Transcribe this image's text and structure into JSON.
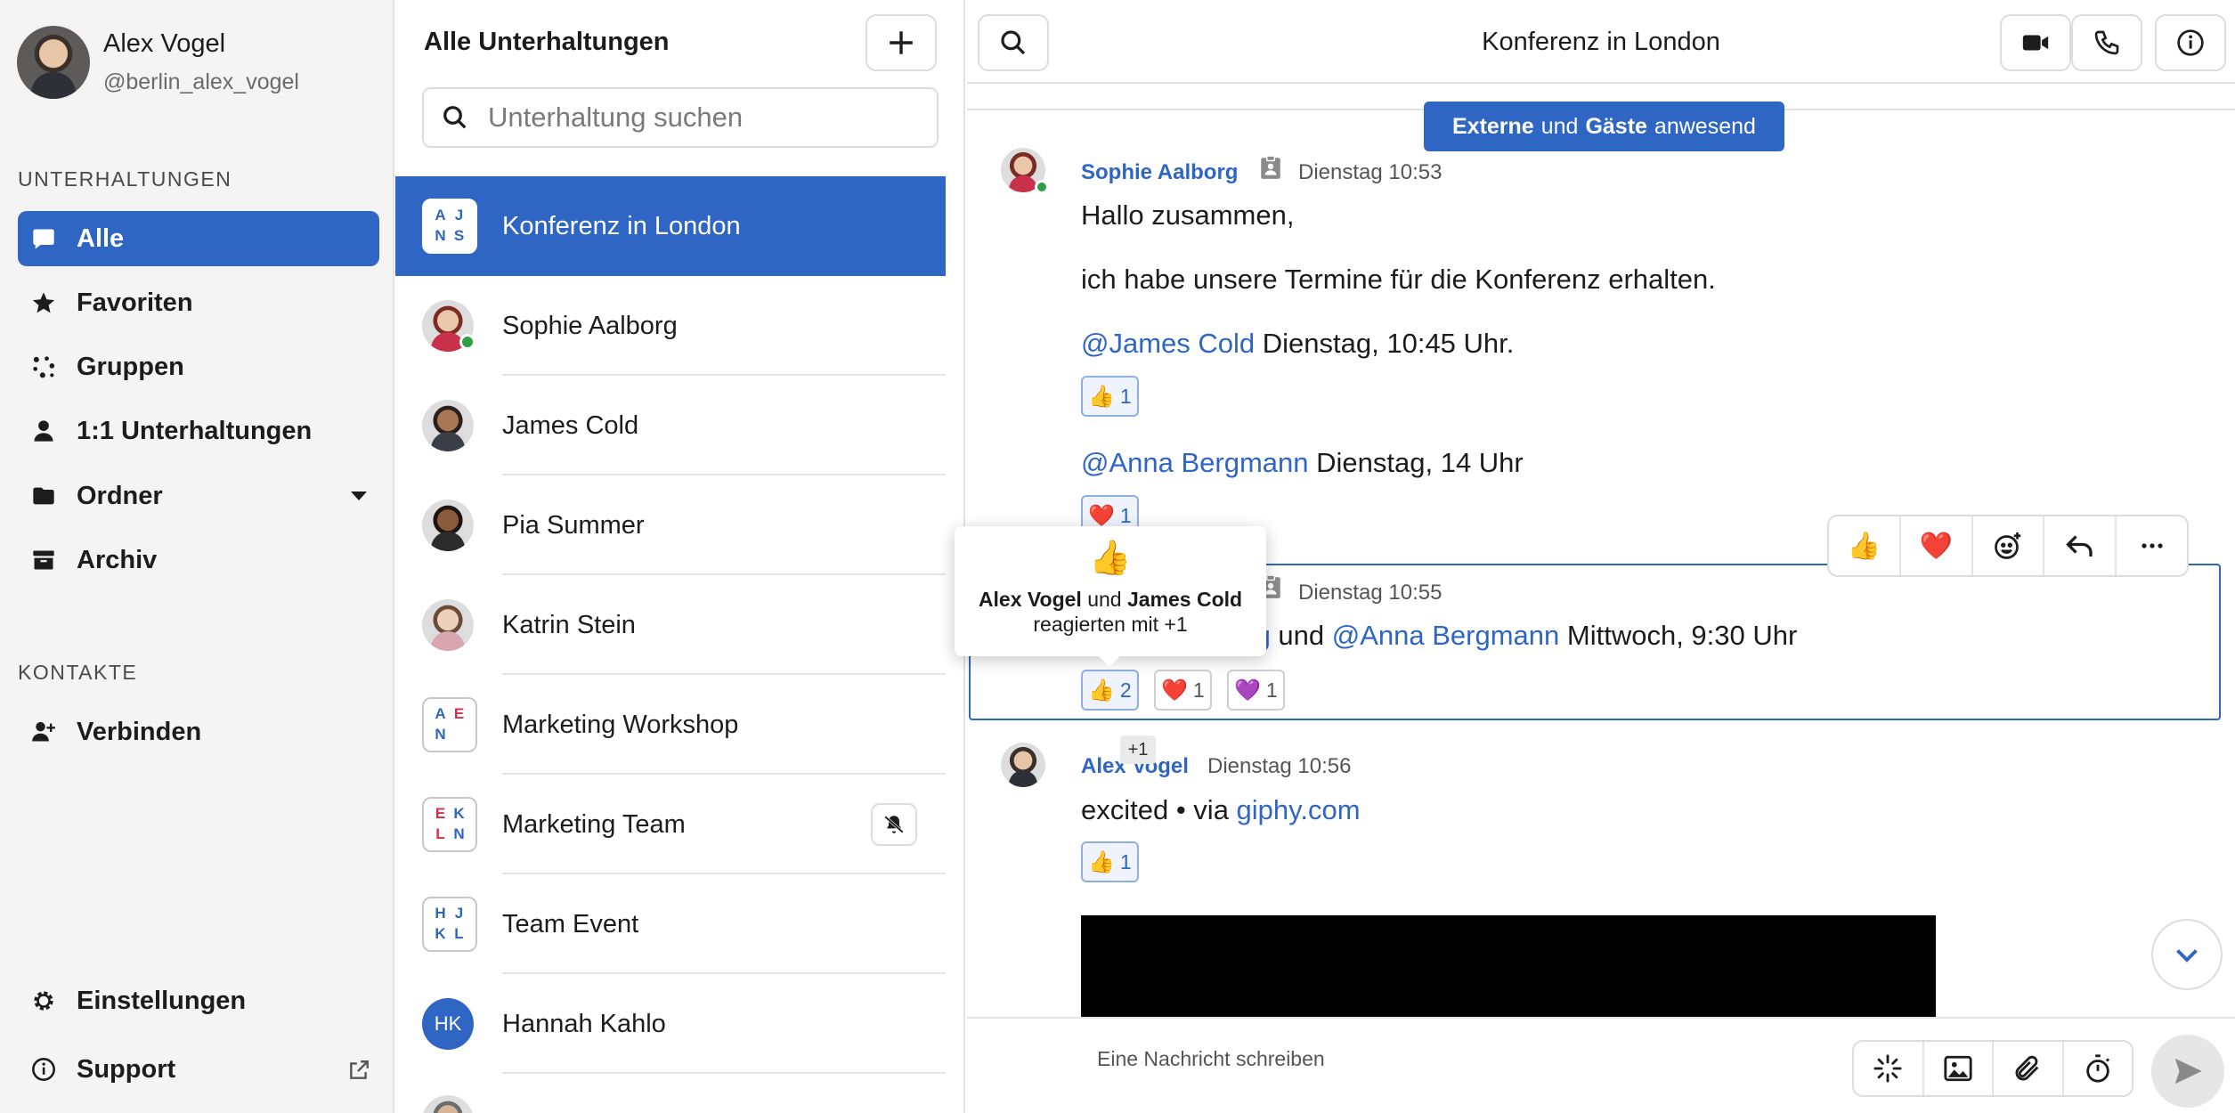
{
  "profile": {
    "name": "Alex Vogel",
    "handle": "@berlin_alex_vogel"
  },
  "sidebar": {
    "section_conversations": "UNTERHALTUNGEN",
    "items": [
      {
        "label": "Alle",
        "icon": "chat-bubble-icon",
        "active": true
      },
      {
        "label": "Favoriten",
        "icon": "star-icon"
      },
      {
        "label": "Gruppen",
        "icon": "dots-group-icon"
      },
      {
        "label": "1:1 Unterhaltungen",
        "icon": "person-icon"
      },
      {
        "label": "Ordner",
        "icon": "folder-icon"
      },
      {
        "label": "Archiv",
        "icon": "archive-icon"
      }
    ],
    "section_contacts": "KONTAKTE",
    "connect_label": "Verbinden",
    "settings_label": "Einstellungen",
    "support_label": "Support"
  },
  "convlist": {
    "title": "Alle Unterhaltungen",
    "search_placeholder": "Unterhaltung suchen",
    "items": [
      {
        "name": "Konferenz in London",
        "type": "group",
        "initials": [
          "A",
          "J",
          "N",
          "S"
        ],
        "active": true
      },
      {
        "name": "Sophie Aalborg",
        "type": "person",
        "online": true
      },
      {
        "name": "James Cold",
        "type": "person"
      },
      {
        "name": "Pia Summer",
        "type": "person"
      },
      {
        "name": "Katrin Stein",
        "type": "person"
      },
      {
        "name": "Marketing Workshop",
        "type": "group",
        "initials": [
          "A",
          "E",
          "N",
          ""
        ]
      },
      {
        "name": "Marketing Team",
        "type": "group",
        "initials": [
          "E",
          "K",
          "L",
          "N"
        ],
        "muted": true
      },
      {
        "name": "Team Event",
        "type": "group",
        "initials": [
          "H",
          "J",
          "K",
          "L"
        ]
      },
      {
        "name": "Hannah Kahlo",
        "type": "initials",
        "initials_text": "HK"
      }
    ]
  },
  "chat": {
    "title": "Konferenz in London",
    "banner": {
      "part1": "Externe",
      "part2": "und",
      "part3": "Gäste",
      "part4": "anwesend"
    },
    "messages": {
      "m1": {
        "sender": "Sophie Aalborg",
        "time": "Dienstag 10:53",
        "line1": "Hallo zusammen,",
        "line2": "ich habe unsere Termine für die Konferenz erhalten.",
        "line3_mention": "@James Cold",
        "line3_text": " Dienstag, 10:45 Uhr.",
        "line4_mention": "@Anna Bergmann",
        "line4_text": " Dienstag, 14 Uhr",
        "reaction1": {
          "emoji": "👍",
          "count": "1"
        },
        "reaction2": {
          "emoji": "❤️",
          "count": "1"
        }
      },
      "m2": {
        "time": "Dienstag 10:55",
        "mention_partial": "erg",
        "joiner": " und ",
        "mention2": "@Anna Bergmann",
        "text": " Mittwoch, 9:30 Uhr",
        "reactions": [
          {
            "emoji": "👍",
            "count": "2"
          },
          {
            "emoji": "❤️",
            "count": "1"
          },
          {
            "emoji": "💜",
            "count": "1"
          }
        ]
      },
      "m3": {
        "sender": "Alex Vogel",
        "time": "Dienstag 10:56",
        "text": "excited • via ",
        "link": "giphy.com",
        "reaction": {
          "emoji": "👍",
          "count": "1"
        }
      }
    },
    "tooltip": {
      "emoji": "👍",
      "name1": "Alex Vogel",
      "joiner": " und ",
      "name2": "James Cold",
      "line2": "reagierten mit +1"
    },
    "plus_badge": "+1",
    "actions": [
      "👍",
      "❤️"
    ],
    "composer_placeholder": "Eine Nachricht schreiben"
  },
  "colors": {
    "accent": "#2f66c4",
    "online": "#2f9e44",
    "heart": "#e0245e"
  }
}
